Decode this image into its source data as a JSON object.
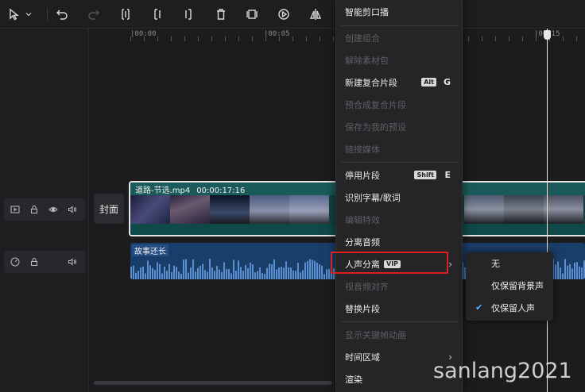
{
  "toolbar": {
    "tools": [
      {
        "name": "select-pointer-icon",
        "disabled": false
      },
      {
        "name": "chevron-down-icon",
        "disabled": false
      },
      {
        "name": "undo-icon",
        "disabled": false
      },
      {
        "name": "redo-icon",
        "disabled": true
      },
      {
        "name": "split-icon",
        "disabled": false
      },
      {
        "name": "trim-left-icon",
        "disabled": false
      },
      {
        "name": "trim-right-icon",
        "disabled": false
      },
      {
        "name": "delete-icon",
        "disabled": false
      },
      {
        "name": "freeze-frame-icon",
        "disabled": false
      },
      {
        "name": "play-reverse-icon",
        "disabled": false
      },
      {
        "name": "mirror-icon",
        "disabled": false
      }
    ]
  },
  "ruler": {
    "labels": [
      "|00:00",
      "|00:05",
      "|00:15"
    ]
  },
  "timeline": {
    "cover_label": "封面",
    "video_clip": {
      "filename": "道路-节选.mp4",
      "duration": "00:00:17:16"
    },
    "audio_clip": {
      "label": "故事还长"
    }
  },
  "context_menu": {
    "items": [
      {
        "label": "智能剪口播",
        "disabled": false
      },
      {
        "label": "创建组合",
        "disabled": true
      },
      {
        "label": "解除素材包",
        "disabled": true
      },
      {
        "label": "新建复合片段",
        "disabled": false,
        "badge": "Alt",
        "key": "G"
      },
      {
        "label": "预合成复合片段",
        "disabled": true
      },
      {
        "label": "保存为我的预设",
        "disabled": true
      },
      {
        "label": "链接媒体",
        "disabled": true
      },
      {
        "label": "停用片段",
        "disabled": false,
        "badge": "Shift",
        "key": "E"
      },
      {
        "label": "识别字幕/歌词",
        "disabled": false
      },
      {
        "label": "编辑特效",
        "disabled": true
      },
      {
        "label": "分离音频",
        "disabled": false
      },
      {
        "label": "人声分离",
        "disabled": false,
        "vip": "VIP",
        "submenu": true
      },
      {
        "label": "视音频对齐",
        "disabled": true
      },
      {
        "label": "替换片段",
        "disabled": false
      },
      {
        "label": "显示关键帧动画",
        "disabled": true
      },
      {
        "label": "时间区域",
        "disabled": false,
        "submenu": true
      },
      {
        "label": "渲染",
        "disabled": false
      }
    ]
  },
  "submenu": {
    "items": [
      {
        "label": "无",
        "checked": false
      },
      {
        "label": "仅保留背景声",
        "checked": false
      },
      {
        "label": "仅保留人声",
        "checked": true
      }
    ]
  },
  "watermark": "sanlang2021",
  "colors": {
    "accent_check": "#5ab4ff",
    "highlight_red": "#e02020",
    "video_clip": "#1b5a5a",
    "audio_clip": "#1a3e6a"
  }
}
